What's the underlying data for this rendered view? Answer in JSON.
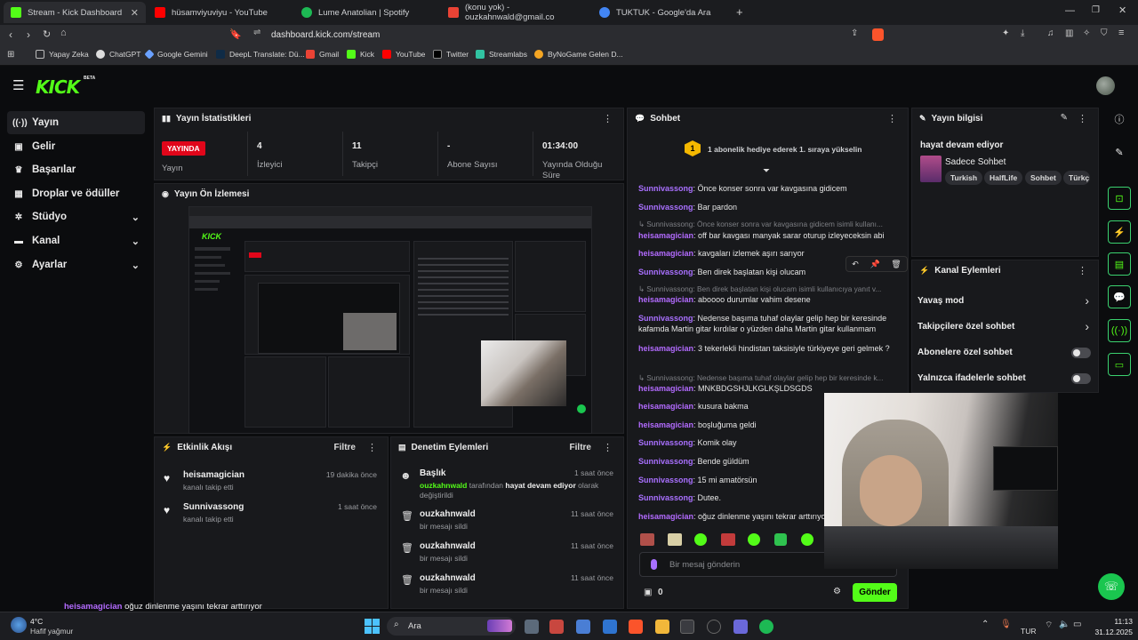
{
  "browser": {
    "tabs": [
      {
        "label": "Stream - Kick Dashboard",
        "active": true,
        "color": "#53fc18"
      },
      {
        "label": "hüsamviyuviyu - YouTube",
        "active": false,
        "color": "#ff0000"
      },
      {
        "label": "Lume Anatolian | Spotify",
        "active": false,
        "color": "#1db954"
      },
      {
        "label": "(konu yok) - ouzkahnwald@gmail.co",
        "active": false,
        "color": "#ea4335"
      },
      {
        "label": "TUKTUK - Google'da Ara",
        "active": false,
        "color": "#4285f4"
      }
    ],
    "new_tab": "+",
    "url": "dashboard.kick.com/stream",
    "bookmarks": [
      "Yapay Zeka",
      "ChatGPT",
      "Google Gemini",
      "DeepL Translate: Dü...",
      "Gmail",
      "Kick",
      "YouTube",
      "Twitter",
      "Streamlabs",
      "ByNoGame Gelen D..."
    ]
  },
  "kick": {
    "logo": "KICK",
    "logo_beta": "BETA",
    "sidebar": [
      {
        "label": "Yayın",
        "icon": "((·))",
        "active": true,
        "chevron": false
      },
      {
        "label": "Gelir",
        "icon": "▣",
        "active": false,
        "chevron": false
      },
      {
        "label": "Başarılar",
        "icon": "🏆",
        "active": false,
        "chevron": false
      },
      {
        "label": "Droplar ve ödüller",
        "icon": "▦",
        "active": false,
        "chevron": false
      },
      {
        "label": "Stüdyo",
        "icon": "✲",
        "active": false,
        "chevron": true
      },
      {
        "label": "Kanal",
        "icon": "▬",
        "active": false,
        "chevron": true
      },
      {
        "label": "Ayarlar",
        "icon": "⚙",
        "active": false,
        "chevron": true
      }
    ],
    "stats": {
      "title": "Yayın İstatistikleri",
      "live_badge": "YAYINDA",
      "live_label": "Yayın",
      "viewers_value": "4",
      "viewers_label": "İzleyici",
      "followers_value": "11",
      "followers_label": "Takipçi",
      "subs_value": "-",
      "subs_label": "Abone Sayısı",
      "duration_value": "01:34:00",
      "duration_label_1": "Yayında Olduğu",
      "duration_label_2": "Süre"
    },
    "preview": {
      "title": "Yayın Ön İzlemesi"
    },
    "activity": {
      "title": "Etkinlik Akışı",
      "filter": "Filtre",
      "items": [
        {
          "name": "heisamagician",
          "sub": "kanalı takip etti",
          "time": "19 dakika önce"
        },
        {
          "name": "Sunnivassong",
          "sub": "kanalı takip etti",
          "time": "1 saat önce"
        }
      ]
    },
    "moderation": {
      "title": "Denetim Eylemleri",
      "filter": "Filtre",
      "items": [
        {
          "name": "Başlık",
          "by": "ouzkahnwald",
          "mid": "tarafından",
          "what": "hayat devam ediyor",
          "tail": "olarak",
          "sub": "değiştirildi",
          "time": "1 saat önce"
        },
        {
          "name": "ouzkahnwald",
          "sub": "bir mesajı sildi",
          "time": "11 saat önce"
        },
        {
          "name": "ouzkahnwald",
          "sub": "bir mesajı sildi",
          "time": "11 saat önce"
        },
        {
          "name": "ouzkahnwald",
          "sub": "bir mesajı sildi",
          "time": "11 saat önce"
        }
      ]
    },
    "chat": {
      "title": "Sohbet",
      "pinned_rank": "1",
      "pinned": "1 abonelik hediye ederek 1. sıraya yükselin",
      "messages": [
        {
          "user": "Sunnivassong",
          "text": "Önce konser sonra var kavgasına gidicem",
          "reply": false
        },
        {
          "user": "Sunnivassong",
          "text": "Bar pardon",
          "reply": false
        },
        {
          "user": "↳ Sunnivassong:",
          "text": "Önce konser sonra var kavgasına gidicem isimli kullanı...",
          "reply": true
        },
        {
          "user": "heisamagician",
          "text": "off bar kavgası manyak sarar oturup izleyeceksin abi",
          "reply": false
        },
        {
          "user": "heisamagician",
          "text": "kavgaları izlemek aşırı sarıyor",
          "reply": false
        },
        {
          "user": "Sunnivassong",
          "text": "Ben direk başlatan kişi olucam",
          "reply": false
        },
        {
          "user": "↳ Sunnivassong:",
          "text": "Ben direk başlatan kişi olucam isimli kullanıcıya yanıt v...",
          "reply": true
        },
        {
          "user": "heisamagician",
          "text": "aboooo durumlar vahim desene",
          "reply": false
        },
        {
          "user": "Sunnivassong",
          "text": "Nedense başıma tuhaf olaylar gelip hep bir keresinde kafamda Martin gitar kırdılar o yüzden daha Martin gitar kullanmam",
          "reply": false
        },
        {
          "user": "heisamagician",
          "text": "3 tekerlekli hindistan taksisiyle türkiyeye geri gelmek ?",
          "reply": false
        },
        {
          "user": "↳ Sunnivassong:",
          "text": "Nedense başıma tuhaf olaylar gelip hep bir keresinde k...",
          "reply": true
        },
        {
          "user": "heisamagician",
          "text": "MNKBDGSHJLKGLKŞLDSGDS",
          "reply": false
        },
        {
          "user": "heisamagician",
          "text": "kusura bakma",
          "reply": false
        },
        {
          "user": "heisamagician",
          "text": "boşluğuma geldi",
          "reply": false
        },
        {
          "user": "Sunnivassong",
          "text": "Komik olay",
          "reply": false
        },
        {
          "user": "Sunnivassong",
          "text": "Bende güldüm",
          "reply": false
        },
        {
          "user": "Sunnivassong",
          "text": "15 mi amatörsün",
          "reply": false
        },
        {
          "user": "Sunnivassong",
          "text": "Dutee.",
          "reply": false
        },
        {
          "user": "heisamagician",
          "text": "oğuz dinlenme yaşını tekrar arttırıyor",
          "reply": false
        }
      ],
      "input_placeholder": "Bir mesaj gönderin",
      "points": "0",
      "send": "Gönder"
    },
    "stream_info": {
      "title": "Yayın bilgisi",
      "stream_title": "hayat devam ediyor",
      "category": "Sadece Sohbet",
      "tags": [
        "Turkish",
        "HalfLife",
        "Sohbet",
        "Türkç"
      ]
    },
    "channel_actions": {
      "title": "Kanal Eylemleri",
      "items": [
        {
          "label": "Yavaş mod",
          "kind": "chevron"
        },
        {
          "label": "Takipçilere özel sohbet",
          "kind": "chevron"
        },
        {
          "label": "Abonelere özel sohbet",
          "kind": "toggle"
        },
        {
          "label": "Yalnızca ifadelerle sohbet",
          "kind": "toggle"
        }
      ]
    },
    "overlay_caption": {
      "user": "heisamagician",
      "text": "oğuz dinlenme yaşını tekrar arttırıyor"
    }
  },
  "taskbar": {
    "weather_temp": "4°C",
    "weather_desc": "Hafif yağmur",
    "search": "Ara",
    "lang": "TUR",
    "time": "11:13",
    "date": "31.12.2025"
  }
}
